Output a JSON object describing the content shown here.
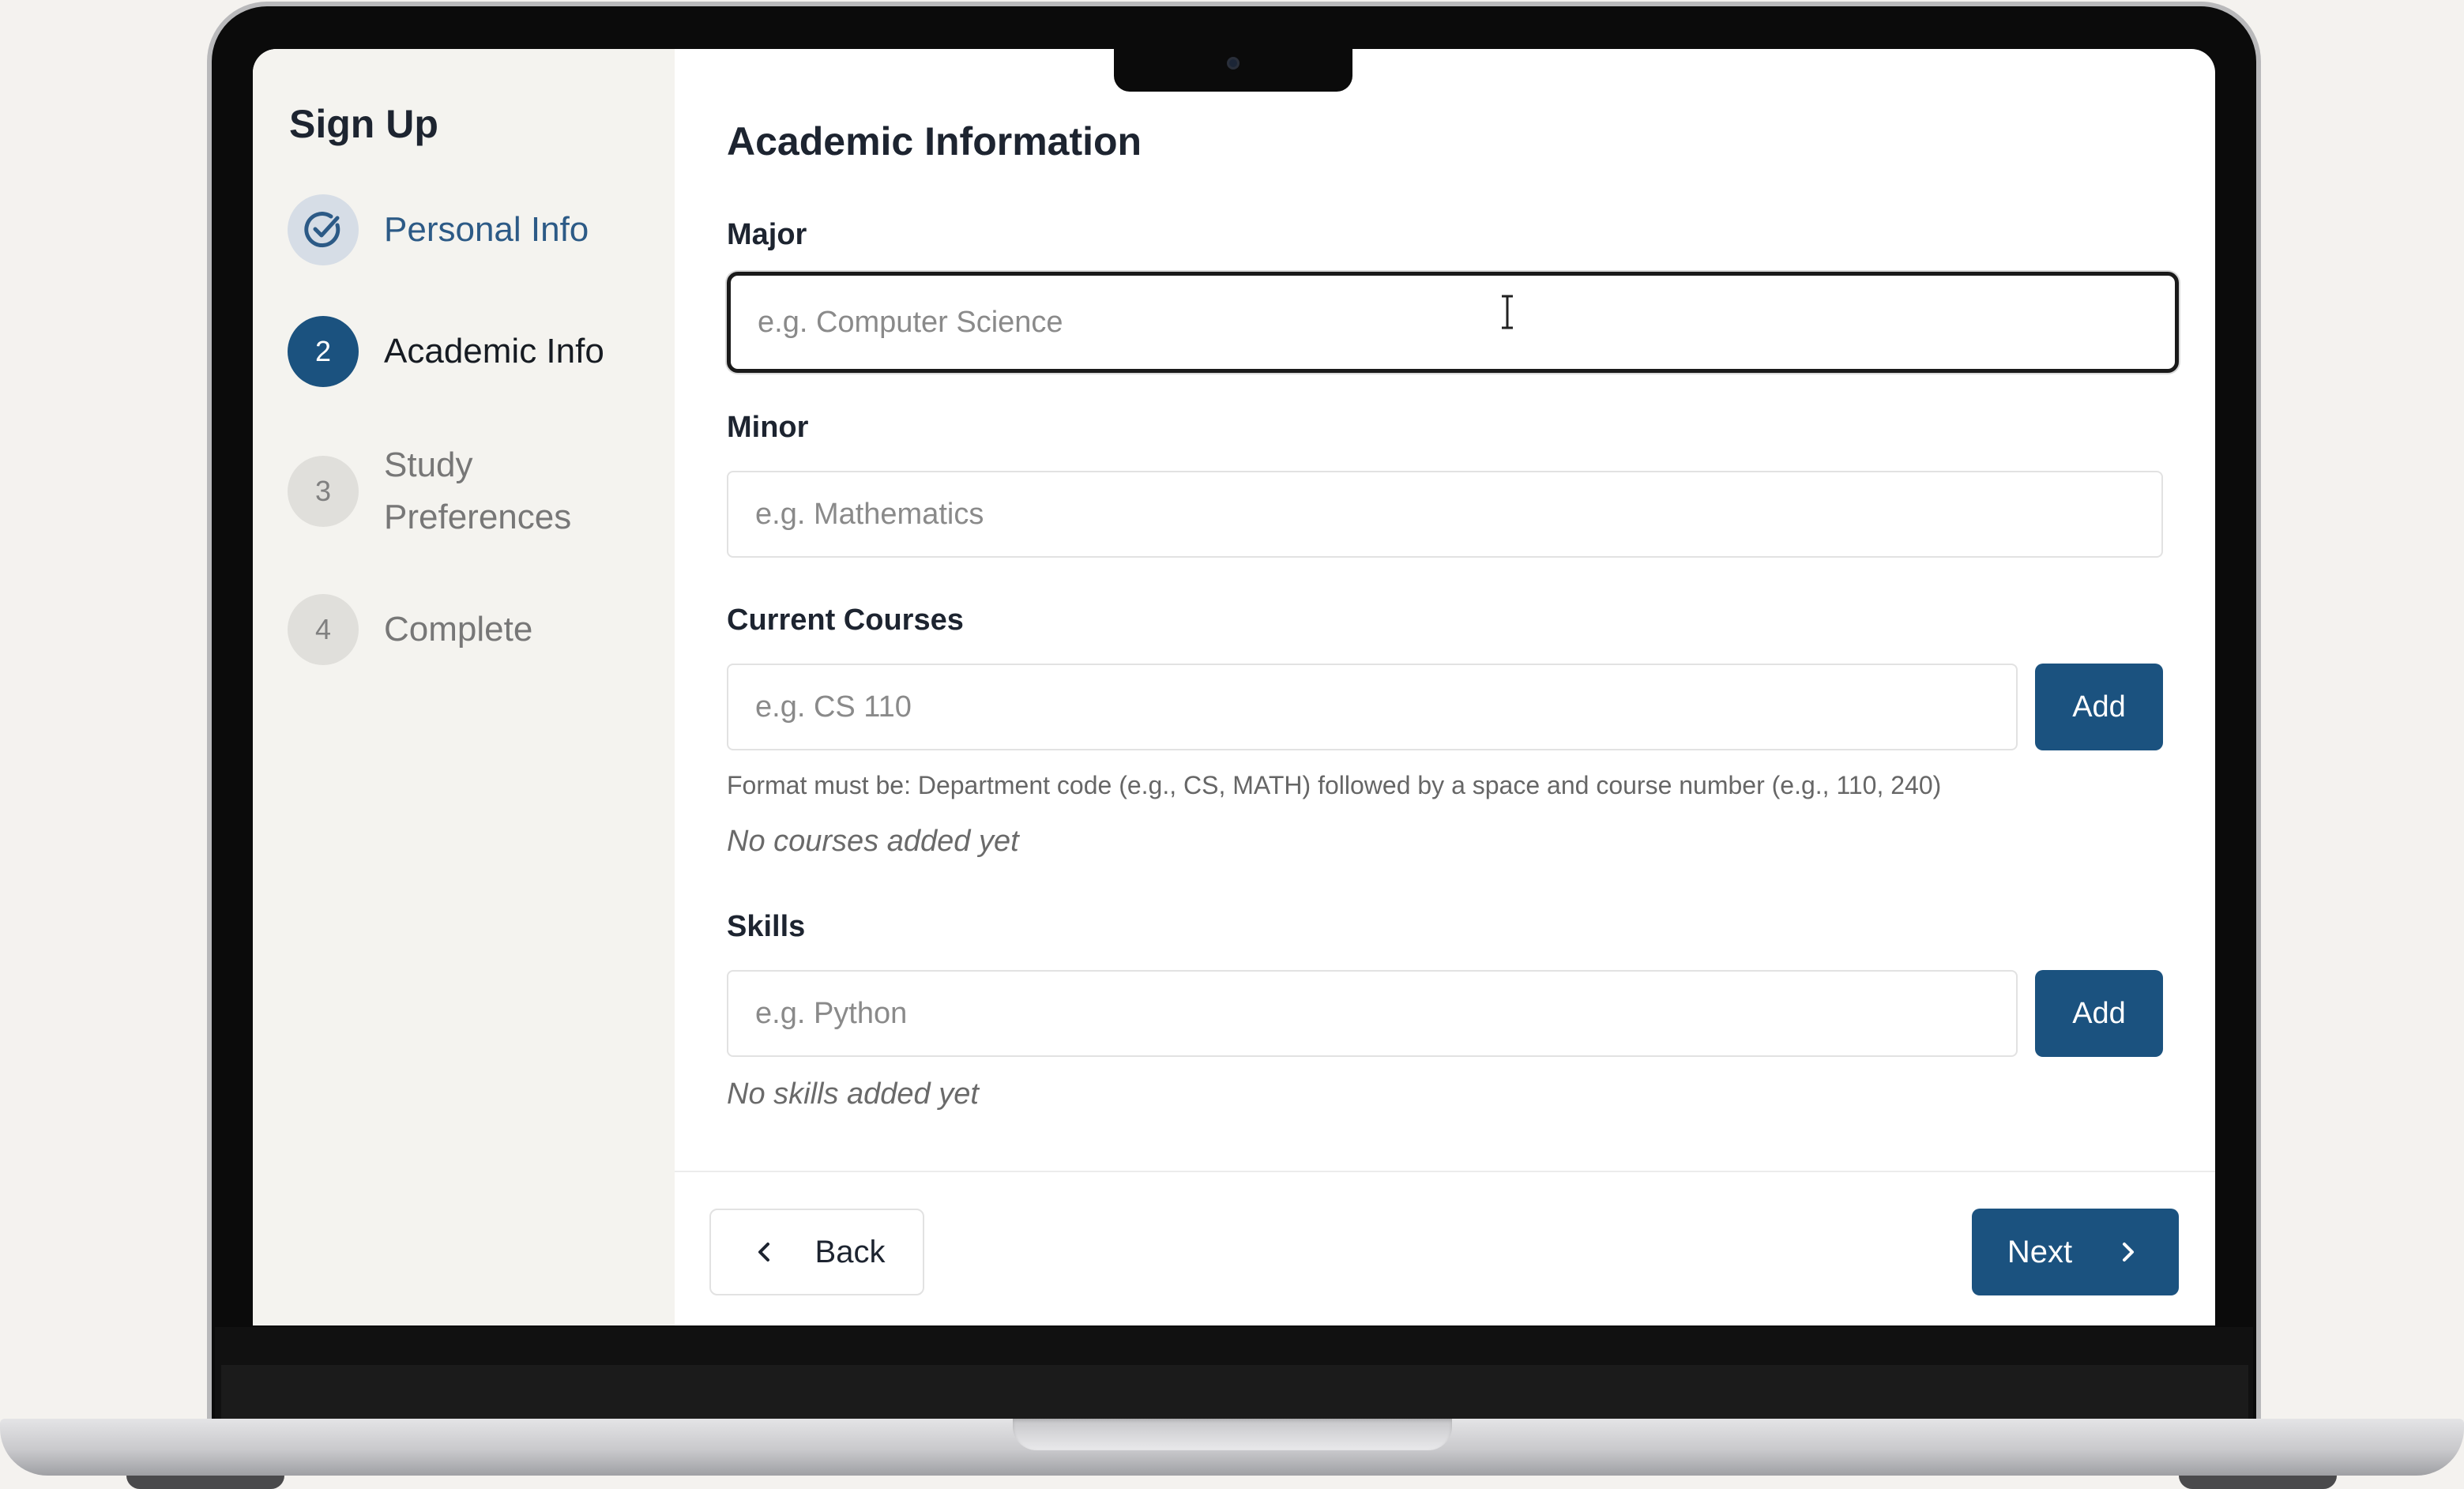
{
  "sidebar": {
    "title": "Sign Up",
    "steps": [
      {
        "number": "",
        "label": "Personal Info",
        "state": "completed",
        "icon": "check-circle-icon"
      },
      {
        "number": "2",
        "label": "Academic Info",
        "state": "active"
      },
      {
        "number": "3",
        "label": "Study Preferences",
        "state": "pending"
      },
      {
        "number": "4",
        "label": "Complete",
        "state": "pending"
      }
    ]
  },
  "form": {
    "title": "Academic Information",
    "major": {
      "label": "Major",
      "placeholder": "e.g. Computer Science",
      "value": ""
    },
    "minor": {
      "label": "Minor",
      "placeholder": "e.g. Mathematics",
      "value": ""
    },
    "courses": {
      "label": "Current Courses",
      "placeholder": "e.g. CS 110",
      "add_label": "Add",
      "helper": "Format must be: Department code (e.g., CS, MATH) followed by a space and course number (e.g., 110, 240)",
      "empty": "No courses added yet"
    },
    "skills": {
      "label": "Skills",
      "placeholder": "e.g. Python",
      "add_label": "Add",
      "empty": "No skills added yet"
    }
  },
  "footer": {
    "back_label": "Back",
    "next_label": "Next"
  },
  "colors": {
    "primary": "#1b527f",
    "sidebar_bg": "#f4f3ef",
    "completed_text": "#2c5a86"
  }
}
